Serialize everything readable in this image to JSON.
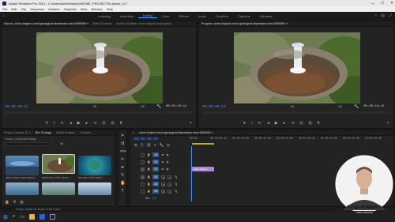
{
  "window": {
    "title": "Adobe Premiere Pro 2021 - C:\\Users\\lam\\Desktop\\ADOBE_PROJECTS\\Lesson_01 *",
    "controls": [
      "—",
      "☐",
      "✕"
    ]
  },
  "menu": [
    "File",
    "Edit",
    "Clip",
    "Sequence",
    "Markers",
    "Graphics",
    "View",
    "Window",
    "Help"
  ],
  "workspaces": {
    "tabs": [
      "Learning",
      "Assembly",
      "Editing",
      "Color",
      "Effects",
      "Audio",
      "Graphics",
      "Captions",
      "Libraries"
    ],
    "active_index": 2
  },
  "source_panel": {
    "tabs": [
      "Source: circle shaped round geological depression area 8490990 ≡",
      "Effect Controls",
      "Audio Clip Mixer: circle shaped round geolo"
    ],
    "timecode_in": "00:00:00:12",
    "timecode_out": "00:00:10:12",
    "fit": "Fit",
    "ratio": "1/2"
  },
  "program_panel": {
    "tabs": [
      "Program: circle shaped round geological depression area 8490990 ≡"
    ],
    "timecode_in": "00:00:00:12",
    "timecode_out": "00:00:18:12",
    "fit": "Fit",
    "ratio": "1/2"
  },
  "transport_icons": [
    "mark-in",
    "mark-out",
    "go-to-in",
    "step-back",
    "play",
    "step-forward",
    "go-to-out",
    "insert",
    "overwrite",
    "export-frame"
  ],
  "project_panel": {
    "tabs": [
      "Project: Lesson_01 ≡",
      "Bin: Footage",
      "Media Browser",
      "Libraries"
    ],
    "bin_path": "Lesson_01.prproj\\Footage",
    "item_count": "34",
    "thumbs": [
      {
        "label": "circle shaped round geolo…",
        "duration": "18:12"
      },
      {
        "label": "aerial view of the ocean…",
        "duration": "10:05"
      },
      {
        "label": "top view of the island…",
        "duration": "15:22"
      },
      {
        "label": "",
        "duration": ""
      },
      {
        "label": "",
        "duration": ""
      },
      {
        "label": "",
        "duration": ""
      }
    ]
  },
  "timeline": {
    "tab": "circle shaped round geological depression area 8490990 ≡",
    "timecode": "00:00:00:00",
    "ruler": [
      "00:00",
      "00:00:05:00",
      "00:00:10:00",
      "00:00:15:00",
      "00:00:20:00",
      "00:00:25:00",
      "00:00:30:00",
      "00:00:35:00",
      "00:00:40:00",
      "00:00:45:00"
    ],
    "video_tracks": [
      "V3",
      "V2",
      "V1"
    ],
    "audio_tracks": [
      "A1",
      "A2",
      "A3"
    ],
    "master": "Mix",
    "master_value": "0.0",
    "clip_label": "circle shaped"
  },
  "status_bar": "Drag to adjust the length of the mask.",
  "presenter": {
    "name": "PETER ROMANOV",
    "role": "VIDEO CREATOR"
  }
}
